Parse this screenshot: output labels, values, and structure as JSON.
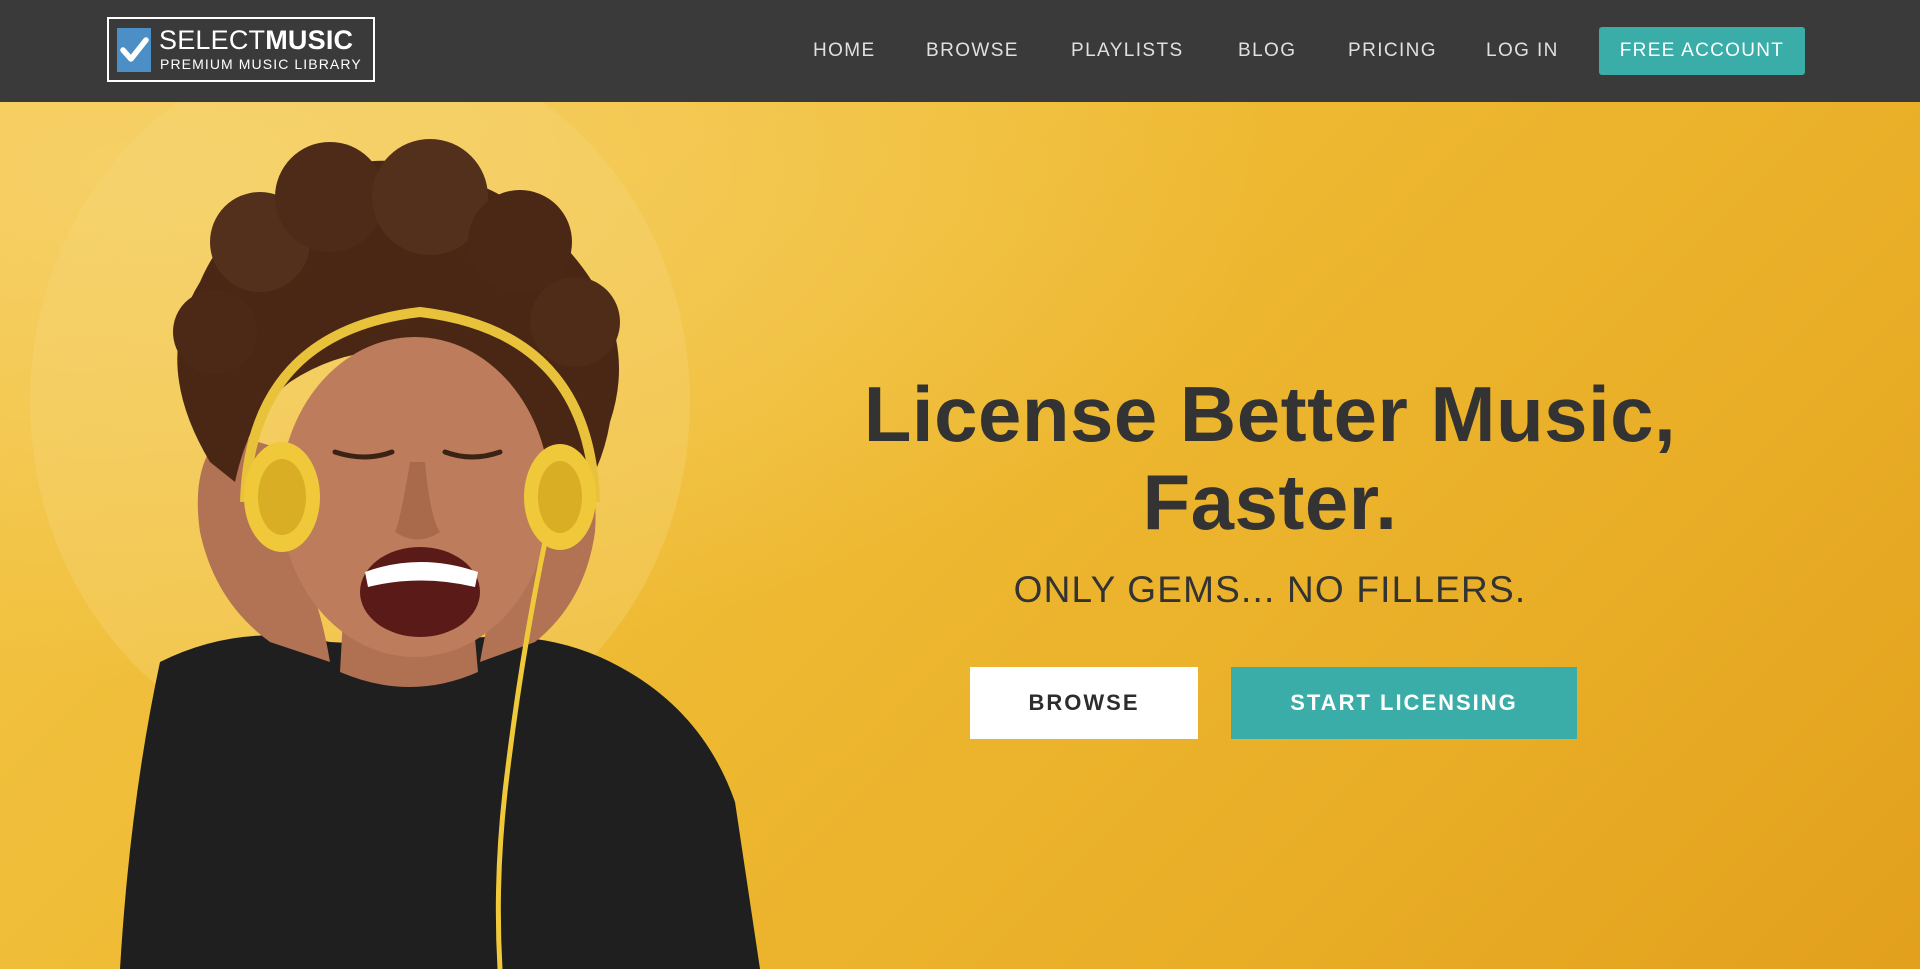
{
  "brand": {
    "name_light": "SELECT",
    "name_bold": "MUSIC",
    "tagline": "PREMIUM MUSIC LIBRARY",
    "logo_color": "#4c8fc6"
  },
  "nav": {
    "items": [
      {
        "label": "HOME"
      },
      {
        "label": "BROWSE"
      },
      {
        "label": "PLAYLISTS"
      },
      {
        "label": "BLOG"
      },
      {
        "label": "PRICING"
      },
      {
        "label": "LOG IN"
      }
    ],
    "cta_label": "FREE ACCOUNT",
    "background": "#3a3a3a",
    "accent": "#3aada8"
  },
  "hero": {
    "headline_line1": "License Better Music,",
    "headline_line2": "Faster.",
    "subhead": "ONLY GEMS... NO FILLERS.",
    "browse_label": "BROWSE",
    "start_label": "START LICENSING",
    "background": "#efbb34",
    "image_description": "woman with curly hair wearing yellow headphones, singing"
  }
}
